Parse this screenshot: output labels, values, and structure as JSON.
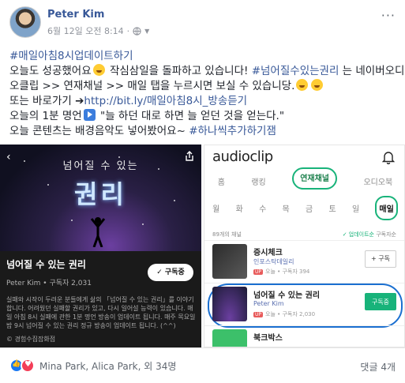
{
  "post": {
    "author": "Peter Kim",
    "timestamp": "6월 12일 오전 8:14",
    "separator": "·",
    "privacy_icon": "globe-icon",
    "more_label": "···",
    "text": {
      "line1_hashtag": "#매일아침8시업데이트하기",
      "line2_a": "오늘도 성공했어요",
      "line2_b": " 작심삼일을 돌파하고 있습니다! ",
      "line2_hashtag": "#넘어질수있는권리",
      "line2_c": " 는 네이버오디",
      "line3": "오클립 >> 연재채널 >> 매일 탭을 누르시면 보실 수 있습니당.",
      "line4_a": "또는 바로가기 ➔",
      "line4_link": "http://bit.ly/매일아침8시_방송듣기",
      "line5_a": "오늘의 1분 명언",
      "line5_b": " \"늘 하던 대로 하면 늘 얻던 것을 얻는다.\"",
      "line6_a": "오늘 콘텐츠는 배경음악도 넣어봤어요~ ",
      "line6_hashtag": "#하나씩추가하기잼"
    }
  },
  "media_left": {
    "back_icon": "back-arrow-icon",
    "share_icon": "share-icon",
    "art_small_title": "넘어질 수 있는",
    "art_big_title": "권리",
    "show_title": "넘어질 수 있는 권리",
    "show_meta": "Peter Kim • 구독자 2,031",
    "subscribe_label": "✓ 구독중",
    "description": "실패와 시작이 두려운 분들에게 삶의 「넘어질 수 있는 권리」를 이야기 합니다. 어려웠던 실패할 권리가 있고, 다시 일어설 능력이 있습니다. 매일 아침 8시 실패에 관한 1분 명언 방송이 업데이트 됩니다. 매주 목요일 밤 9시 넘어질 수 있는 권리 정규 방송이 업데이트 됩니다. (^^)",
    "footer": "© 경험수집잡화점"
  },
  "media_right": {
    "logo": "audioclip",
    "bell_icon": "bell-icon",
    "tabs": [
      "홈",
      "랭킹",
      "연재채널",
      "오디오북"
    ],
    "active_tab": "연재채널",
    "days": [
      "월",
      "화",
      "수",
      "목",
      "금",
      "토",
      "일",
      "매일"
    ],
    "active_day": "매일",
    "count_label": "89개의 채널",
    "sort_label_a": "✓ 업데이트순",
    "sort_label_b": "  구독자순",
    "items": [
      {
        "title": "증시체크",
        "sub": "인포스탁데일리",
        "meta": "오늘 • 구독자 394",
        "button": "+ 구독"
      },
      {
        "title": "넘어질 수 있는 권리",
        "sub": "Peter Kim",
        "meta": "오늘 • 구독자 2,030",
        "button": "구독중"
      },
      {
        "title": "북크박스",
        "sub": "",
        "meta": "",
        "button": ""
      }
    ],
    "up_badge": "UP"
  },
  "footer": {
    "reaction_names": "Mina Park, Alica Park, 외 34명",
    "comments": "댓글 4개"
  },
  "colors": {
    "link": "#385898",
    "accent_green": "#18b37a",
    "annotation_blue": "#1a6fd0"
  }
}
